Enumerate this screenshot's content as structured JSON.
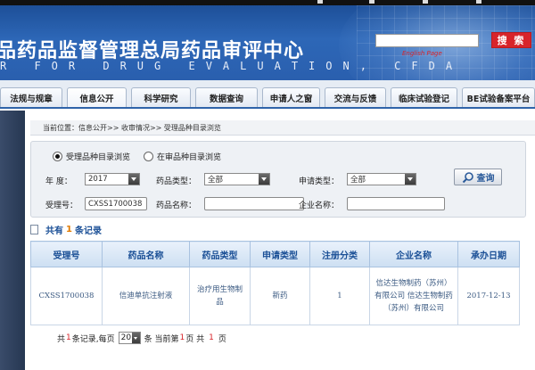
{
  "header": {
    "title_cn": "品药品监督管理总局药品审评中心",
    "title_en": "R FOR DRUG EVALUATION, CFDA",
    "search_button": "搜 索",
    "english_link": "English Page"
  },
  "nav": {
    "tabs": [
      "法规与规章",
      "信息公开",
      "科学研究",
      "数据查询",
      "申请人之窗",
      "交流与反馈",
      "临床试验登记",
      "BE试验备案平台"
    ]
  },
  "breadcrumb": "当前位置：信息公开>> 收审情况>> 受理品种目录浏览",
  "filters": {
    "radio_accepted": "受理品种目录浏览",
    "radio_review": "在审品种目录浏览",
    "year_label": "年    度：",
    "year_value": "2017",
    "drug_type_label": "药品类型：",
    "drug_type_value": "全部",
    "apply_type_label": "申请类型：",
    "apply_type_value": "全部",
    "accept_no_label": "受理号：",
    "accept_no_value": "CXSS1700038",
    "drug_name_label": "药品名称：",
    "drug_name_value": "",
    "company_label": "企业名称：",
    "company_value": "",
    "query_button": "查询"
  },
  "results": {
    "prefix": "共有",
    "count": "1",
    "suffix": "条记录"
  },
  "table": {
    "headers": [
      "受理号",
      "药品名称",
      "药品类型",
      "申请类型",
      "注册分类",
      "企业名称",
      "承办日期"
    ],
    "rows": [
      [
        "CXSS1700038",
        "信迪单抗注射液",
        "治疗用生物制品",
        "新药",
        "1",
        "信达生物制药（苏州）有限公司 信达生物制药（苏州）有限公司",
        "2017-12-13"
      ]
    ]
  },
  "pager": {
    "t1": "共",
    "total": "1",
    "t2": "条记录,每页",
    "per_page": "20",
    "t3": "条 当前第",
    "current": "1",
    "t4": "页 共",
    "pages": "1",
    "t5": "页"
  }
}
